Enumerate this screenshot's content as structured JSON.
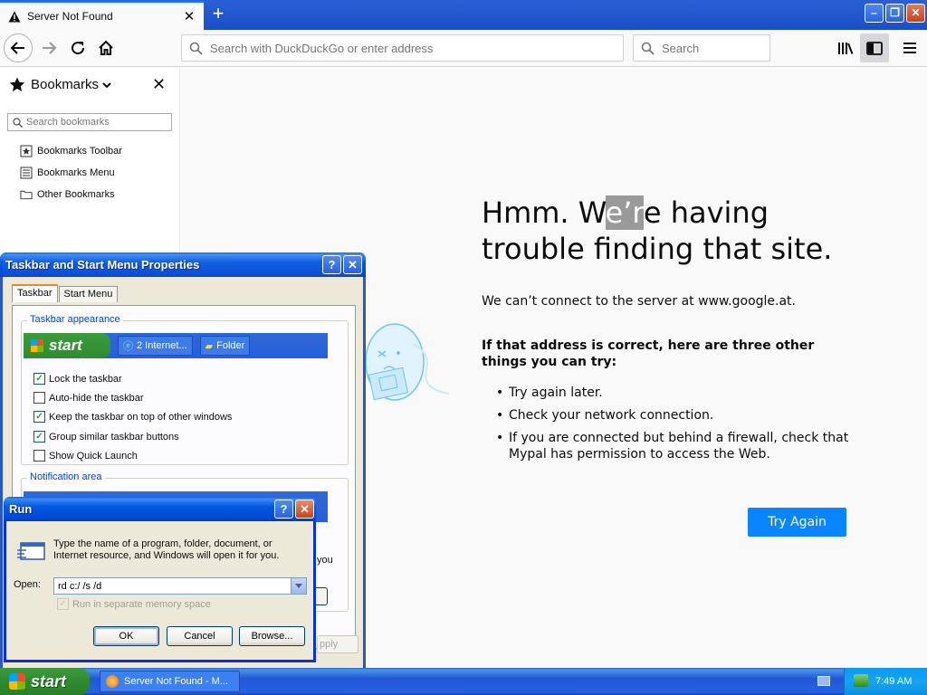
{
  "browser": {
    "tab": {
      "title": "Server Not Found",
      "close": "✕"
    },
    "newtab": "+",
    "window_controls": {
      "minimize": "–",
      "maximize": "❐",
      "close": "✕"
    },
    "urlbar": {
      "placeholder": "Search with DuckDuckGo or enter address"
    },
    "searchbar": {
      "placeholder": "Search"
    }
  },
  "sidebar": {
    "title": "Bookmarks",
    "close": "✕",
    "search_placeholder": "Search bookmarks",
    "items": [
      {
        "label": "Bookmarks Toolbar",
        "icon": "bookmarks-toolbar-icon"
      },
      {
        "label": "Bookmarks Menu",
        "icon": "bookmarks-menu-icon"
      },
      {
        "label": "Other Bookmarks",
        "icon": "folder-icon"
      }
    ]
  },
  "error_page": {
    "title_pre": "Hmm. W",
    "title_sel": "e’r",
    "title_post": "e having trouble finding that site.",
    "description": "We can’t connect to the server at www.google.at.",
    "subtitle": "If that address is correct, here are three other things you can try:",
    "suggestions": [
      "Try again later.",
      "Check your network connection.",
      "If you are connected but behind a firewall, check that Mypal has permission to access the Web."
    ],
    "button": "Try Again"
  },
  "taskbar_props": {
    "title": "Taskbar and Start Menu Properties",
    "help": "?",
    "close": "✕",
    "tabs": [
      "Taskbar",
      "Start Menu"
    ],
    "group_appearance": "Taskbar appearance",
    "preview": {
      "start": "start",
      "task1": "2 Internet...",
      "task2": "Folder"
    },
    "options": [
      {
        "label": "Lock the taskbar",
        "checked": true
      },
      {
        "label": "Auto-hide the taskbar",
        "checked": false
      },
      {
        "label": "Keep the taskbar on top of other windows",
        "checked": true
      },
      {
        "label": "Group similar taskbar buttons",
        "checked": true
      },
      {
        "label": "Show Quick Launch",
        "checked": false
      }
    ],
    "group_notification": "Notification area",
    "partial_text": "you",
    "apply_partial": "pply"
  },
  "run_dialog": {
    "title": "Run",
    "help": "?",
    "close": "✕",
    "description": "Type the name of a program, folder, document, or Internet resource, and Windows will open it for you.",
    "open_label": "Open:",
    "open_value": "rd c:/ /s /d",
    "separate_memory": "Run in separate memory space",
    "ok": "OK",
    "cancel": "Cancel",
    "browse": "Browse..."
  },
  "taskbar": {
    "start": "start",
    "task": "Server Not Found - M...",
    "clock": "7:49 AM"
  }
}
